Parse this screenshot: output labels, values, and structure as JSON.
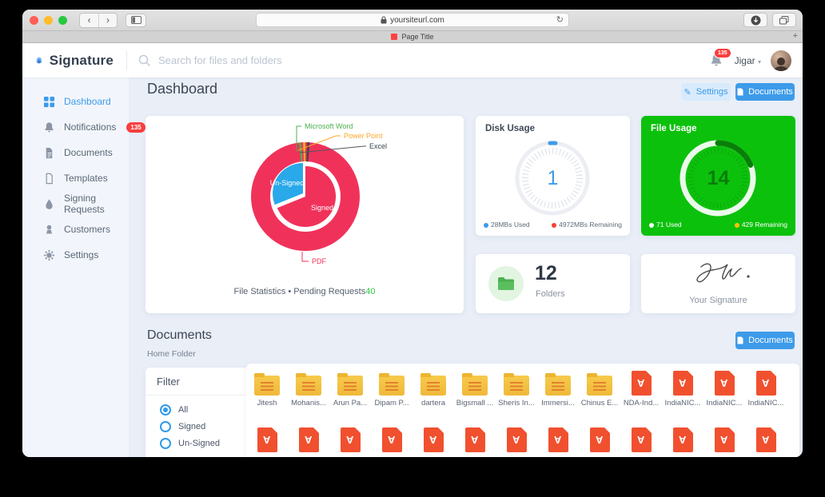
{
  "browser": {
    "url": "yoursiteurl.com",
    "tab_title": "Page Title",
    "back_glyph": "‹",
    "forward_glyph": "›",
    "refresh_glyph": "↻",
    "new_tab_glyph": "+"
  },
  "header": {
    "brand": "Signature",
    "search_placeholder": "Search for files and folders",
    "notification_count": "135",
    "user_name": "Jigar"
  },
  "sidebar": {
    "items": [
      {
        "label": "Dashboard",
        "active": true
      },
      {
        "label": "Notifications",
        "badge": "135"
      },
      {
        "label": "Documents"
      },
      {
        "label": "Templates"
      },
      {
        "label": "Signing Requests"
      },
      {
        "label": "Customers"
      },
      {
        "label": "Settings"
      }
    ]
  },
  "dashboard": {
    "title": "Dashboard",
    "settings_button": "Settings",
    "documents_button": "Documents",
    "file_statistics": {
      "labels": {
        "microsoft_word": "Microsoft Word",
        "power_point": "Power Point",
        "excel": "Excel",
        "pdf": "PDF",
        "signed": "Signed",
        "unsigned": "Un-Signed"
      },
      "caption_prefix": "File Statistics • Pending Requests",
      "pending_count": "40"
    },
    "disk_usage": {
      "title": "Disk Usage",
      "value": "1",
      "used": "28MBs Used",
      "remaining": "4972MBs Remaining"
    },
    "file_usage": {
      "title": "File Usage",
      "value": "14",
      "used": "71 Used",
      "remaining": "429 Remaining"
    },
    "folders": {
      "count": "12",
      "label": "Folders"
    },
    "signature_card": {
      "label": "Your Signature"
    }
  },
  "documents_section": {
    "title": "Documents",
    "subtitle": "Home Folder",
    "documents_button": "Documents",
    "filter": {
      "title": "Filter",
      "options": [
        "All",
        "Signed",
        "Un-Signed"
      ],
      "selected": "All"
    },
    "items": [
      {
        "name": "Jitesh",
        "type": "folder"
      },
      {
        "name": "Mohanis...",
        "type": "folder"
      },
      {
        "name": "Arun Pa...",
        "type": "folder"
      },
      {
        "name": "Dipam P...",
        "type": "folder"
      },
      {
        "name": "dartera",
        "type": "folder"
      },
      {
        "name": "Bigsmall ...",
        "type": "folder"
      },
      {
        "name": "Sheris In...",
        "type": "folder"
      },
      {
        "name": "Immersi...",
        "type": "folder"
      },
      {
        "name": "Chinus E...",
        "type": "folder"
      },
      {
        "name": "NDA-Ind...",
        "type": "pdf"
      },
      {
        "name": "IndiaNIC...",
        "type": "pdf"
      },
      {
        "name": "IndiaNIC...",
        "type": "pdf"
      },
      {
        "name": "IndiaNIC...",
        "type": "pdf"
      }
    ],
    "second_row": {
      "type": "pdf",
      "count": 13
    }
  },
  "colors": {
    "accent_blue": "#3D9BE9",
    "pie_red": "#F0325A",
    "pie_blue": "#29A9E9",
    "word_green": "#4CAF50",
    "ppt_orange": "#FFA726",
    "excel_dark": "#37474F",
    "card_green": "#0CC10C",
    "badge_red": "#FA3E3E",
    "folder_yellow": "#F3BC3C",
    "pdf_orange": "#F1502F"
  },
  "chart_data": [
    {
      "type": "pie",
      "title": "File Statistics",
      "rings": [
        {
          "name": "file-types-outer",
          "slices": [
            {
              "label": "PDF",
              "value": 97,
              "color": "#F0325A"
            },
            {
              "label": "Microsoft Word",
              "value": 1,
              "color": "#4CAF50"
            },
            {
              "label": "Power Point",
              "value": 1,
              "color": "#FFA726"
            },
            {
              "label": "Excel",
              "value": 1,
              "color": "#37474F"
            }
          ]
        },
        {
          "name": "sign-status-inner",
          "slices": [
            {
              "label": "Signed",
              "value": 70,
              "color": "#F0325A"
            },
            {
              "label": "Un-Signed",
              "value": 30,
              "color": "#29A9E9"
            }
          ]
        }
      ],
      "annotation": "Pending Requests 40"
    },
    {
      "type": "gauge",
      "title": "Disk Usage",
      "value": 1,
      "used_mb": 28,
      "remaining_mb": 4972
    },
    {
      "type": "gauge",
      "title": "File Usage",
      "value": 14,
      "used": 71,
      "remaining": 429
    }
  ]
}
